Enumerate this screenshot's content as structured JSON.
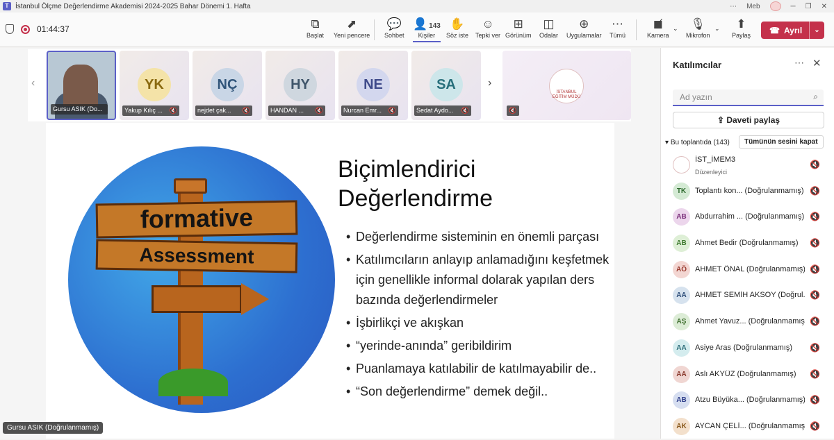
{
  "window": {
    "title": "İstanbul Ölçme Değerlendirme Akademisi 2024-2025 Bahar Dönemi 1. Hafta",
    "user": "Meb"
  },
  "toolbar": {
    "timer": "01:44:37",
    "buttons": [
      {
        "label": "Başlat",
        "icon": "share-screen-icon"
      },
      {
        "label": "Yeni pencere",
        "icon": "new-window-icon"
      },
      {
        "label": "Sohbet",
        "icon": "chat-icon"
      },
      {
        "label": "Kişiler",
        "icon": "people-icon",
        "count": "143"
      },
      {
        "label": "Söz iste",
        "icon": "raise-hand-icon"
      },
      {
        "label": "Tepki ver",
        "icon": "react-icon"
      },
      {
        "label": "Görünüm",
        "icon": "view-icon"
      },
      {
        "label": "Odalar",
        "icon": "rooms-icon"
      },
      {
        "label": "Uygulamalar",
        "icon": "apps-icon"
      },
      {
        "label": "Tümü",
        "icon": "more-icon"
      },
      {
        "label": "Kamera",
        "icon": "camera-off-icon"
      },
      {
        "label": "Mikrofon",
        "icon": "mic-off-icon"
      },
      {
        "label": "Paylaş",
        "icon": "share-icon"
      }
    ],
    "leave_label": "Ayrıl"
  },
  "strip": {
    "tiles": [
      {
        "initials": "",
        "name": "Gursu ASIK (Do...",
        "video": true
      },
      {
        "initials": "YK",
        "name": "Yakup Kılıç ...",
        "color": "#f4e3a8",
        "text": "#8a6a10"
      },
      {
        "initials": "NÇ",
        "name": "nejdet çak...",
        "color": "#c9d6e6",
        "text": "#31557a"
      },
      {
        "initials": "HY",
        "name": "HANDAN ...",
        "color": "#cfd7df",
        "text": "#3f556a"
      },
      {
        "initials": "NE",
        "name": "Nurcan Emr...",
        "color": "#d3d7ee",
        "text": "#3f4a8a"
      },
      {
        "initials": "SA",
        "name": "Sedat Aydo...",
        "color": "#cde6ea",
        "text": "#276f7b"
      }
    ],
    "logo_text": "İSTANBUL EĞİTİM MÜDÜ"
  },
  "slide": {
    "sign_line1": "formative",
    "sign_line2": "Assessment",
    "title": "Biçimlendirici Değerlendirme",
    "bullets": [
      "Değerlendirme sisteminin en önemli parçası",
      "Katılımcıların anlayıp anlamadığını keşfetmek için genellikle informal dolarak yapılan ders bazında değerlendirmeler",
      "İşbirlikçi ve akışkan",
      "“yerinde-anında” geribildirim",
      "Puanlamaya katılabilir de katılmayabilir de..",
      "“Son değerlendirme” demek değil.."
    ]
  },
  "speaker_label": "Gursu ASIK (Doğrulanmamış)",
  "panel": {
    "title": "Katılımcılar",
    "search_placeholder": "Ad yazın",
    "share_label": "Daveti paylaş",
    "section_label": "Bu toplantıda (143)",
    "mute_all_label": "Tümünün sesini kapat",
    "participants": [
      {
        "initials": "",
        "name": "İST_İMEM3",
        "sub": "Düzenleyici",
        "logo": true
      },
      {
        "initials": "TK",
        "name": "Toplantı kon... (Doğrulanmamış)",
        "color": "#d4ead4",
        "text": "#2e6b2e"
      },
      {
        "initials": "AB",
        "name": "Abdurrahim ... (Doğrulanmamış)",
        "color": "#ecd6ec",
        "text": "#7a2e7a"
      },
      {
        "initials": "AB",
        "name": "Ahmet Bedir (Doğrulanmamış)",
        "color": "#deefd6",
        "text": "#3e7a2e"
      },
      {
        "initials": "AÖ",
        "name": "AHMET ÖNAL (Doğrulanmamış)",
        "color": "#f3d6d2",
        "text": "#9a3a2e"
      },
      {
        "initials": "AA",
        "name": "AHMET SEMİH AKSOY (Doğrul...",
        "color": "#d6e2ee",
        "text": "#2e4e7a"
      },
      {
        "initials": "AŞ",
        "name": "Ahmet Yavuz... (Doğrulanmamış)",
        "color": "#dcecd6",
        "text": "#3e6e2e"
      },
      {
        "initials": "AA",
        "name": "Asiye Aras (Doğrulanmamış)",
        "color": "#d4ecee",
        "text": "#2e6e7a"
      },
      {
        "initials": "AA",
        "name": "Aslı AKYÜZ (Doğrulanmamış)",
        "color": "#f0d6d2",
        "text": "#8a3a2e"
      },
      {
        "initials": "AB",
        "name": "Atzu Büyüka... (Doğrulanmamış)",
        "color": "#d6def0",
        "text": "#2e3e8a"
      },
      {
        "initials": "AK",
        "name": "AYCAN ÇELİ... (Doğrulanmamış)",
        "color": "#f3e0cc",
        "text": "#8a5a1e"
      }
    ]
  }
}
